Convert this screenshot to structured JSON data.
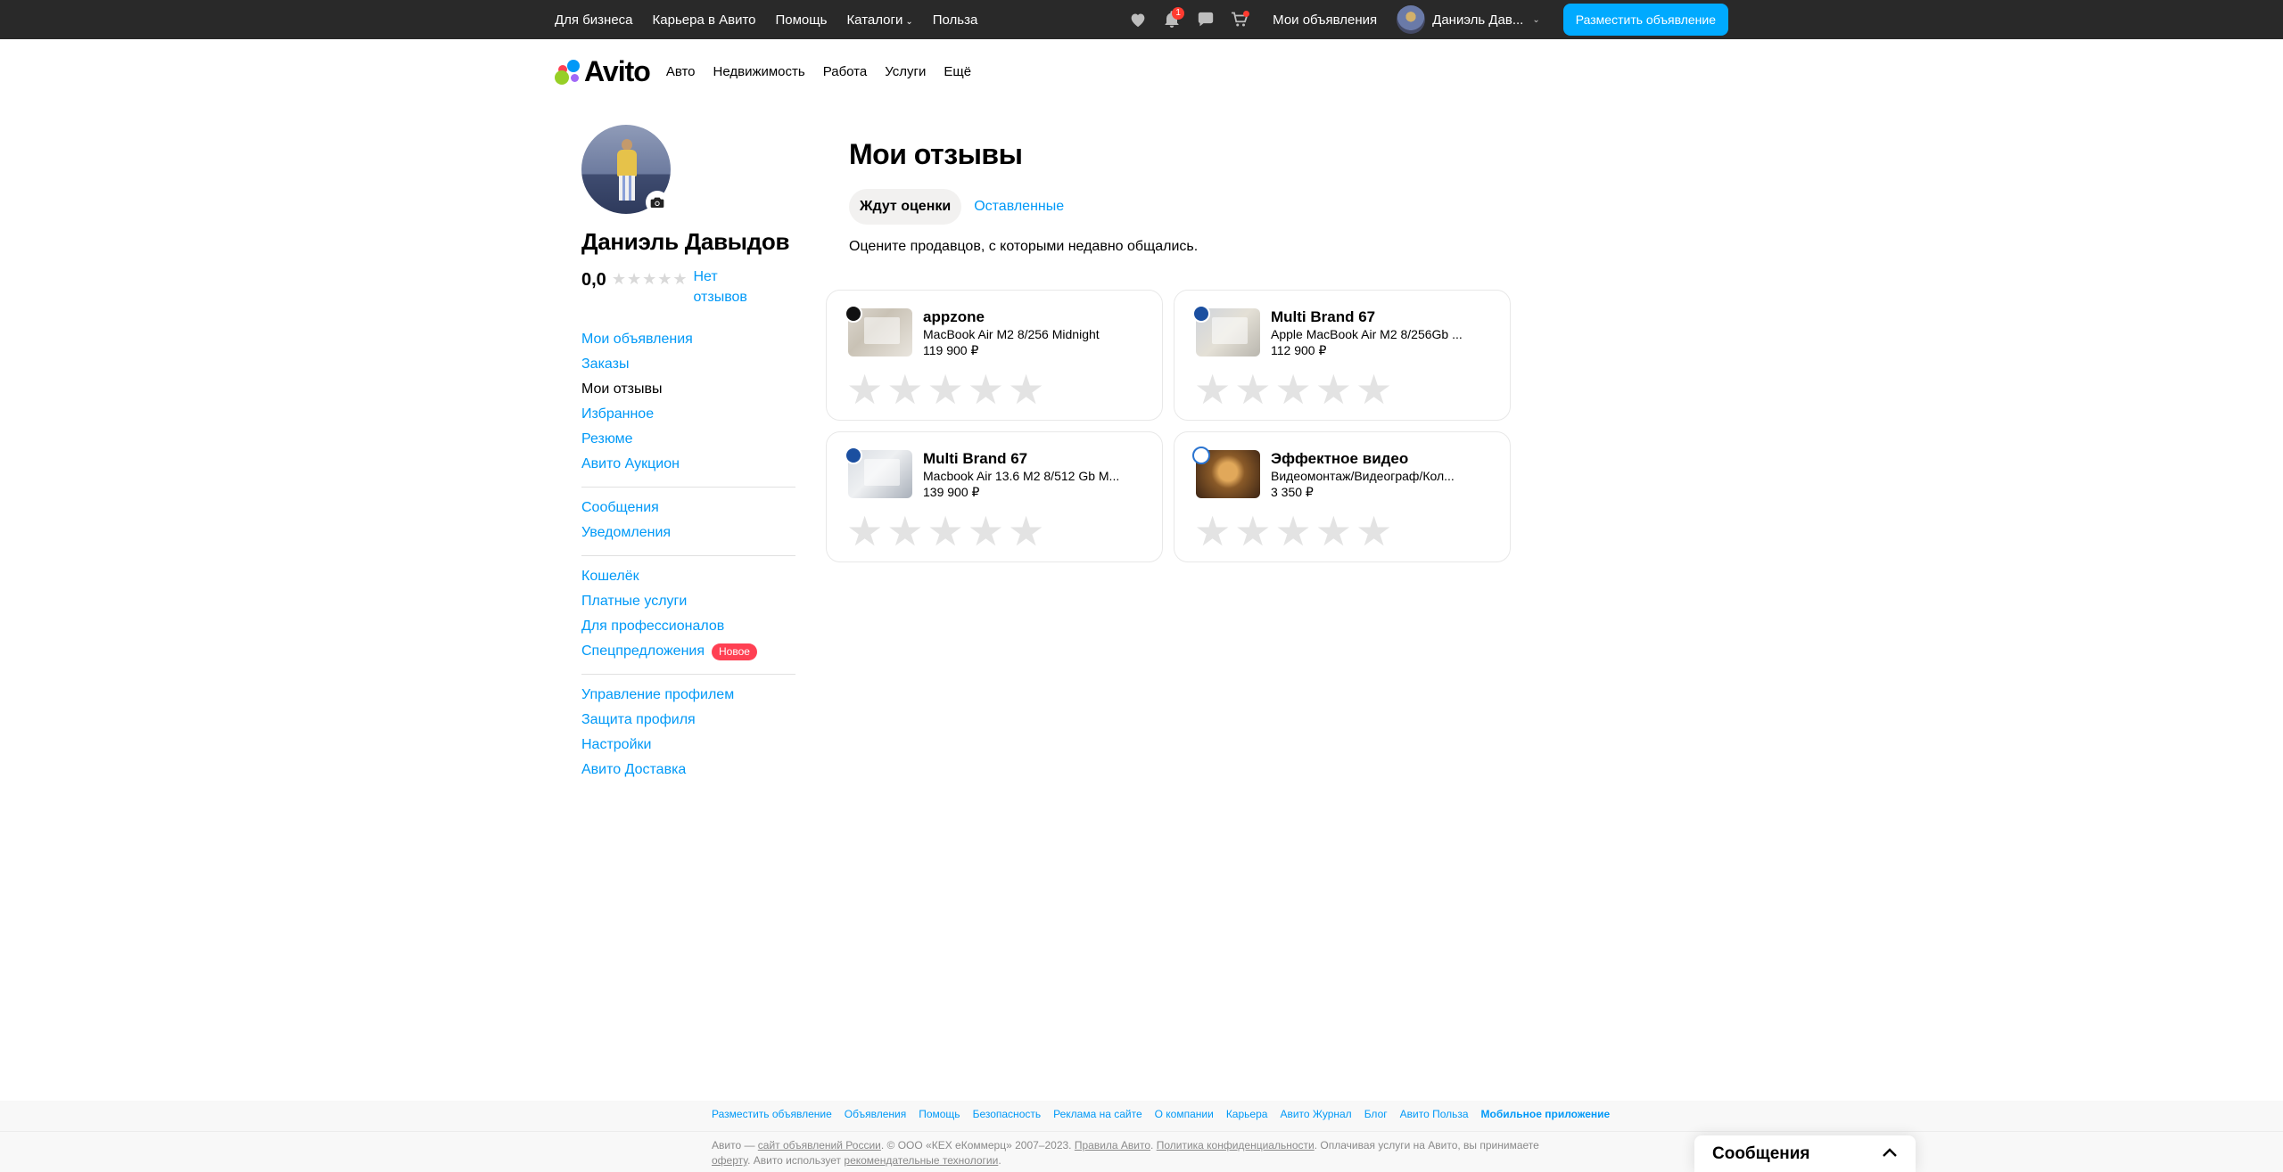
{
  "topbar": {
    "links": [
      "Для бизнеса",
      "Карьера в Авито",
      "Помощь",
      "Каталоги",
      "Польза"
    ],
    "notifications_count": "1",
    "my_ads": "Мои объявления",
    "user_name": "Даниэль Дав...",
    "post_button": "Разместить объявление"
  },
  "header": {
    "logo": "Avito",
    "nav": [
      "Авто",
      "Недвижимость",
      "Работа",
      "Услуги",
      "Ещё"
    ]
  },
  "profile": {
    "name": "Даниэль Давыдов",
    "rating": "0,0",
    "no_reviews": "Нет отзывов"
  },
  "menu": {
    "group1": [
      "Мои объявления",
      "Заказы",
      "Мои отзывы",
      "Избранное",
      "Резюме",
      "Авито Аукцион"
    ],
    "group2": [
      "Сообщения",
      "Уведомления"
    ],
    "group3": [
      "Кошелёк",
      "Платные услуги",
      "Для профессионалов",
      "Спецпредложения"
    ],
    "new_badge": "Новое",
    "group4": [
      "Управление профилем",
      "Защита профиля",
      "Настройки",
      "Авито Доставка"
    ]
  },
  "main": {
    "title": "Мои отзывы",
    "tab_waiting": "Ждут оценки",
    "tab_left": "Оставленные",
    "subtitle": "Оцените продавцов, с которыми недавно общались."
  },
  "cards": [
    {
      "seller": "appzone",
      "title": "MacBook Air M2 8/256 Midnight",
      "price": "119 900 ₽"
    },
    {
      "seller": "Multi Brand 67",
      "title": "Apple MacBook Air M2 8/256Gb ...",
      "price": "112 900 ₽"
    },
    {
      "seller": "Multi Brand 67",
      "title": "Macbook Air 13.6 M2 8/512 Gb M...",
      "price": "139 900 ₽"
    },
    {
      "seller": "Эффектное видео",
      "title": "Видеомонтаж/Видеограф/Кол...",
      "price": "3 350 ₽"
    }
  ],
  "footer": {
    "links": [
      "Разместить объявление",
      "Объявления",
      "Помощь",
      "Безопасность",
      "Реклама на сайте",
      "О компании",
      "Карьера",
      "Авито Журнал",
      "Блог",
      "Авито Польза",
      "Мобильное приложение"
    ],
    "legal_1": "Авито — ",
    "legal_site": "сайт объявлений России",
    "legal_2": ". © ООО «КЕХ еКоммерц» 2007–2023. ",
    "legal_rules": "Правила Авито",
    "legal_3": ". ",
    "legal_privacy": "Политика конфиденциальности",
    "legal_4": ". Оплачивая услуги на Авито, вы принимаете ",
    "legal_offer": "оферту",
    "legal_5": ". Авито использует ",
    "legal_tech": "рекомендательные технологии",
    "legal_6": "."
  },
  "messages_widget": {
    "title": "Сообщения"
  },
  "colors": {
    "topbar_bg": "#292929",
    "accent_blue": "#0099f7",
    "post_button": "#00aaff",
    "badge_red": "#ff4053"
  }
}
